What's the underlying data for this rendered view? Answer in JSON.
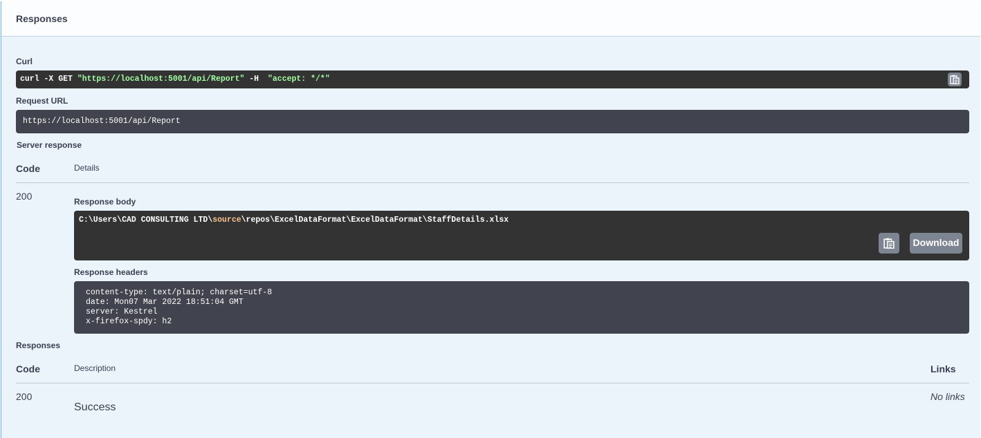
{
  "section": {
    "title": "Responses"
  },
  "curl": {
    "label": "Curl",
    "command": "curl -X GET",
    "url": "\"https://localhost:5001/api/Report\"",
    "flag": "-H",
    "header": "\"accept: */*\""
  },
  "request_url": {
    "label": "Request URL",
    "value": "https://localhost:5001/api/Report"
  },
  "server_response": {
    "label": "Server response",
    "table_head": {
      "code": "Code",
      "details": "Details"
    },
    "code": "200",
    "body_label": "Response body",
    "body_parts": {
      "before": "C:\\Users\\CAD CONSULTING LTD\\",
      "highlight": "source",
      "after": "\\repos\\ExcelDataFormat\\ExcelDataFormat\\StaffDetails.xlsx"
    },
    "download_label": "Download",
    "headers_label": "Response headers",
    "headers": [
      "content-type: text/plain; charset=utf-8",
      "date: Mon07 Mar 2022 18:51:04 GMT",
      "server: Kestrel",
      "x-firefox-spdy: h2"
    ]
  },
  "responses": {
    "label": "Responses",
    "table_head": {
      "code": "Code",
      "description": "Description",
      "links": "Links"
    },
    "rows": [
      {
        "code": "200",
        "description": "Success",
        "links": "No links"
      }
    ]
  },
  "icons": {
    "copy": "clipboard-copy-icon"
  },
  "colors": {
    "panel_bg": "#ebf3fb",
    "accent": "#61affe",
    "code_dark": "#333333",
    "code_slate": "#41444e",
    "string_green": "#a2fca2",
    "button_gray": "#7d8492"
  }
}
